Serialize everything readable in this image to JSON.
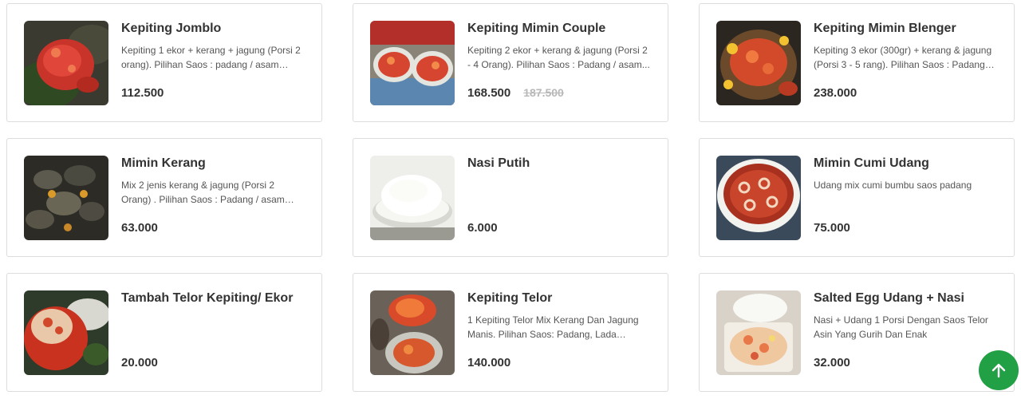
{
  "colors": {
    "accent": "#22a045",
    "title": "#333333",
    "description": "#555555",
    "old_price": "#b8b8b8",
    "card_border": "#dddddd"
  },
  "menu": {
    "items": [
      {
        "name": "Kepiting Jomblo",
        "description": "Kepiting 1 ekor + kerang + jagung (Porsi 2 orang). Pilihan Saos : padang / asam mani...",
        "price": "112.500",
        "old_price": "",
        "image": "crab-dish-photo"
      },
      {
        "name": "Kepiting Mimin Couple",
        "description": "Kepiting 2 ekor + kerang & jagung (Porsi 2 - 4 Orang). Pilihan Saos : Padang / asam...",
        "price": "168.500",
        "old_price": "187.500",
        "image": "crab-couple-photo"
      },
      {
        "name": "Kepiting Mimin Blenger",
        "description": "Kepiting 3 ekor (300gr) + kerang & jagung (Porsi 3 - 5 rang). Pilihan Saos : Padang /...",
        "price": "238.000",
        "old_price": "",
        "image": "crab-platter-photo"
      },
      {
        "name": "Mimin Kerang",
        "description": "Mix 2 jenis kerang & jagung (Porsi 2 Orang) . Pilihan Saos : Padang / asam manis / lad...",
        "price": "63.000",
        "old_price": "",
        "image": "clams-photo"
      },
      {
        "name": "Nasi Putih",
        "description": "",
        "price": "6.000",
        "old_price": "",
        "image": "white-rice-photo"
      },
      {
        "name": "Mimin Cumi Udang",
        "description": "Udang mix cumi bumbu saos padang",
        "price": "75.000",
        "old_price": "",
        "image": "squid-shrimp-photo"
      },
      {
        "name": "Tambah Telor Kepiting/ Ekor",
        "description": "",
        "price": "20.000",
        "old_price": "",
        "image": "crab-roe-photo"
      },
      {
        "name": "Kepiting Telor",
        "description": "1 Kepiting Telor Mix Kerang Dan Jagung Manis. Pilihan Saos: Padang, Lada Hitam...",
        "price": "140.000",
        "old_price": "",
        "image": "crab-egg-photo"
      },
      {
        "name": "Salted Egg Udang + Nasi",
        "description": "Nasi + Udang 1 Porsi Dengan Saos Telor Asin Yang Gurih Dan Enak",
        "price": "32.000",
        "old_price": "",
        "image": "salted-egg-shrimp-photo"
      }
    ]
  },
  "scroll_top": {
    "icon": "arrow-up-icon"
  }
}
